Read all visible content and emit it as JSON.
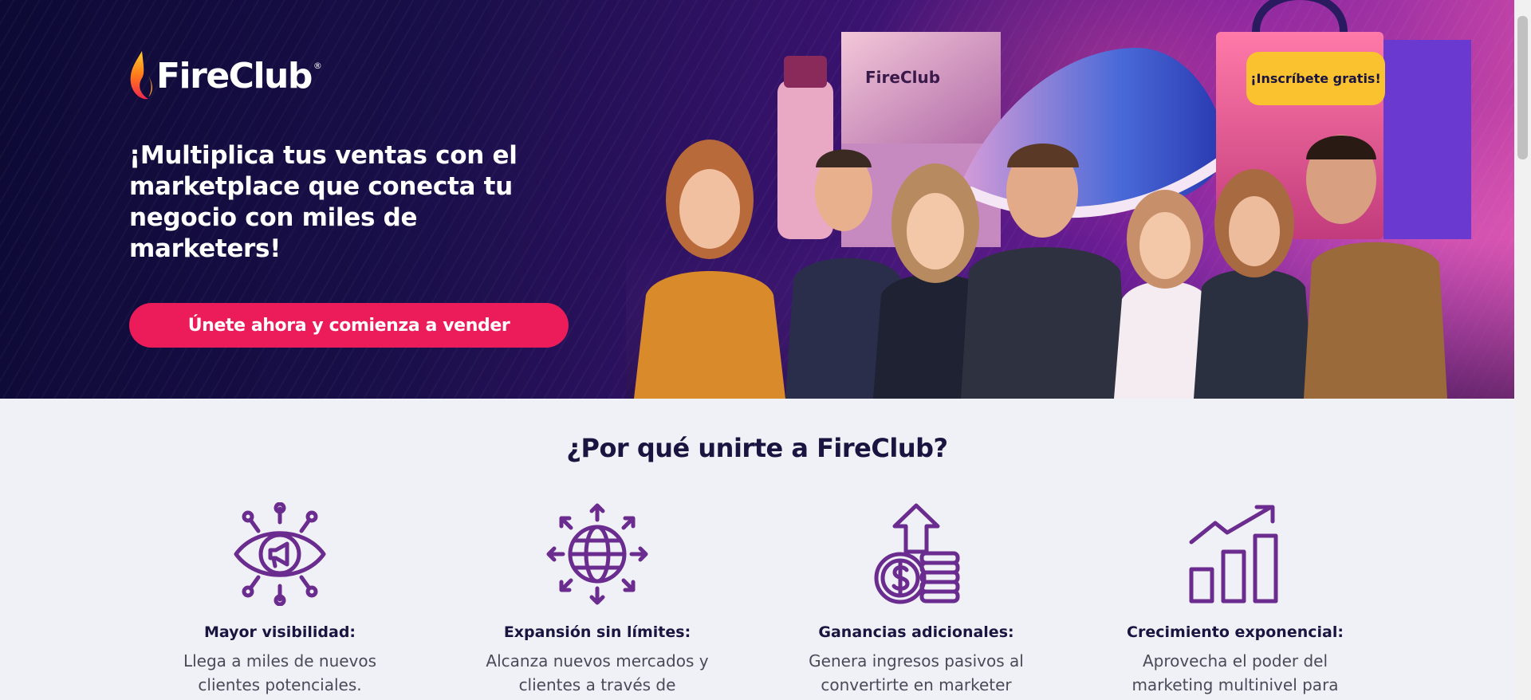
{
  "hero": {
    "logo_text": "FireClub",
    "logo_reg": "®",
    "title": "¡Multiplica tus ventas con el marketplace que conecta tu negocio con miles de marketers!",
    "cta_label": "Únete ahora y comienza a vender",
    "signup_label": "¡Inscríbete gratis!",
    "product_box_text": "FireClub"
  },
  "why": {
    "title": "¿Por qué unirte a FireClub?",
    "features": [
      {
        "icon": "eye-megaphone-icon",
        "title": "Mayor visibilidad:",
        "text": "Llega a miles de nuevos clientes potenciales."
      },
      {
        "icon": "globe-arrows-icon",
        "title": "Expansión sin límites:",
        "text": "Alcanza nuevos mercados y clientes a través de"
      },
      {
        "icon": "coins-dollar-icon",
        "title": "Ganancias adicionales:",
        "text": "Genera ingresos pasivos al convertirte en marketer"
      },
      {
        "icon": "growth-chart-icon",
        "title": "Crecimiento exponencial:",
        "text": "Aprovecha el poder del marketing multinivel para"
      }
    ]
  },
  "colors": {
    "brand_pink": "#ec1c5a",
    "cta_yellow": "#f9c22e",
    "icon_purple": "#6b2c8f",
    "navy": "#1a1440",
    "section_bg": "#f0f1f7"
  }
}
